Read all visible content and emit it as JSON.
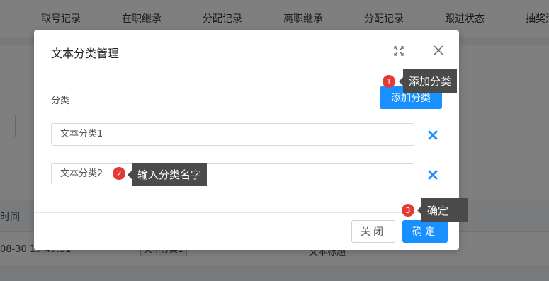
{
  "background": {
    "tabs": [
      "取号记录",
      "在职继承",
      "分配记录",
      "离职继承",
      "分配记录",
      "跟进状态",
      "抽奖活"
    ],
    "table_header_fragment": "时间",
    "row_time_fragment": "08-30 19:49:31",
    "row_tag": "文本分类1",
    "row_title_fragment": "文本标题"
  },
  "dialog": {
    "title": "文本分类管理",
    "category_label": "分类",
    "add_button": "添加分类",
    "categories": [
      {
        "value": "文本分类1"
      },
      {
        "value": "文本分类2"
      }
    ],
    "close_button": "关闭",
    "confirm_button": "确定"
  },
  "callouts": [
    {
      "number": "1",
      "text": "添加分类"
    },
    {
      "number": "2",
      "text": "输入分类名字"
    },
    {
      "number": "3",
      "text": "确定"
    }
  ],
  "colors": {
    "primary": "#1890ff",
    "delete_icon": "#1890ff",
    "badge": "#e53935",
    "tip_bg": "#4a4a4a"
  }
}
